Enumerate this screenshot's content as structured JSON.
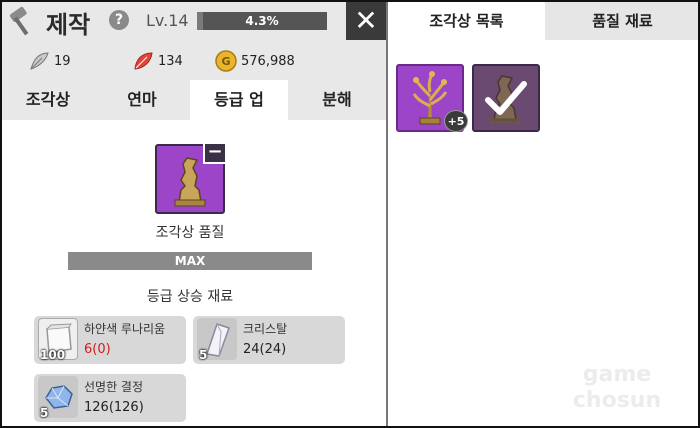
{
  "header": {
    "title": "제작",
    "help_label": "?",
    "level": "Lv.14",
    "exp_percent": "4.3%",
    "exp_fraction": 0.043,
    "close_label": "✕"
  },
  "resources": [
    {
      "icon": "feather-icon",
      "value": "19"
    },
    {
      "icon": "leaf-icon",
      "value": "134"
    },
    {
      "icon": "gold-coin-icon",
      "value": "576,988",
      "coin_letter": "G"
    }
  ],
  "tabs": [
    {
      "label": "조각상",
      "active": false
    },
    {
      "label": "연마",
      "active": false
    },
    {
      "label": "등급 업",
      "active": true
    },
    {
      "label": "분해",
      "active": false
    }
  ],
  "upgrade": {
    "minus_label": "−",
    "quality_label": "조각상 품질",
    "max_label": "MAX",
    "requirement_label": "등급 상승 재료",
    "materials": [
      {
        "name": "하얀색 루나리움",
        "count": "100",
        "value": "6(0)",
        "insufficient": true
      },
      {
        "name": "크리스탈",
        "count": "5",
        "value": "24(24)",
        "insufficient": false
      },
      {
        "name": "선명한 결정",
        "count": "5",
        "value": "126(126)",
        "insufficient": false
      }
    ]
  },
  "right_tabs": [
    {
      "label": "조각상 목록",
      "active": true
    },
    {
      "label": "품질 재료",
      "active": false
    }
  ],
  "list_items": [
    {
      "icon": "golden-tree-statue-icon",
      "badge": "+5"
    },
    {
      "icon": "statue-selected-icon",
      "checked": true
    }
  ],
  "watermark": {
    "line1": "game",
    "line2": "chosun"
  },
  "colors": {
    "accent_purple": "#9c45c8",
    "insufficient_red": "#d41a1a"
  }
}
